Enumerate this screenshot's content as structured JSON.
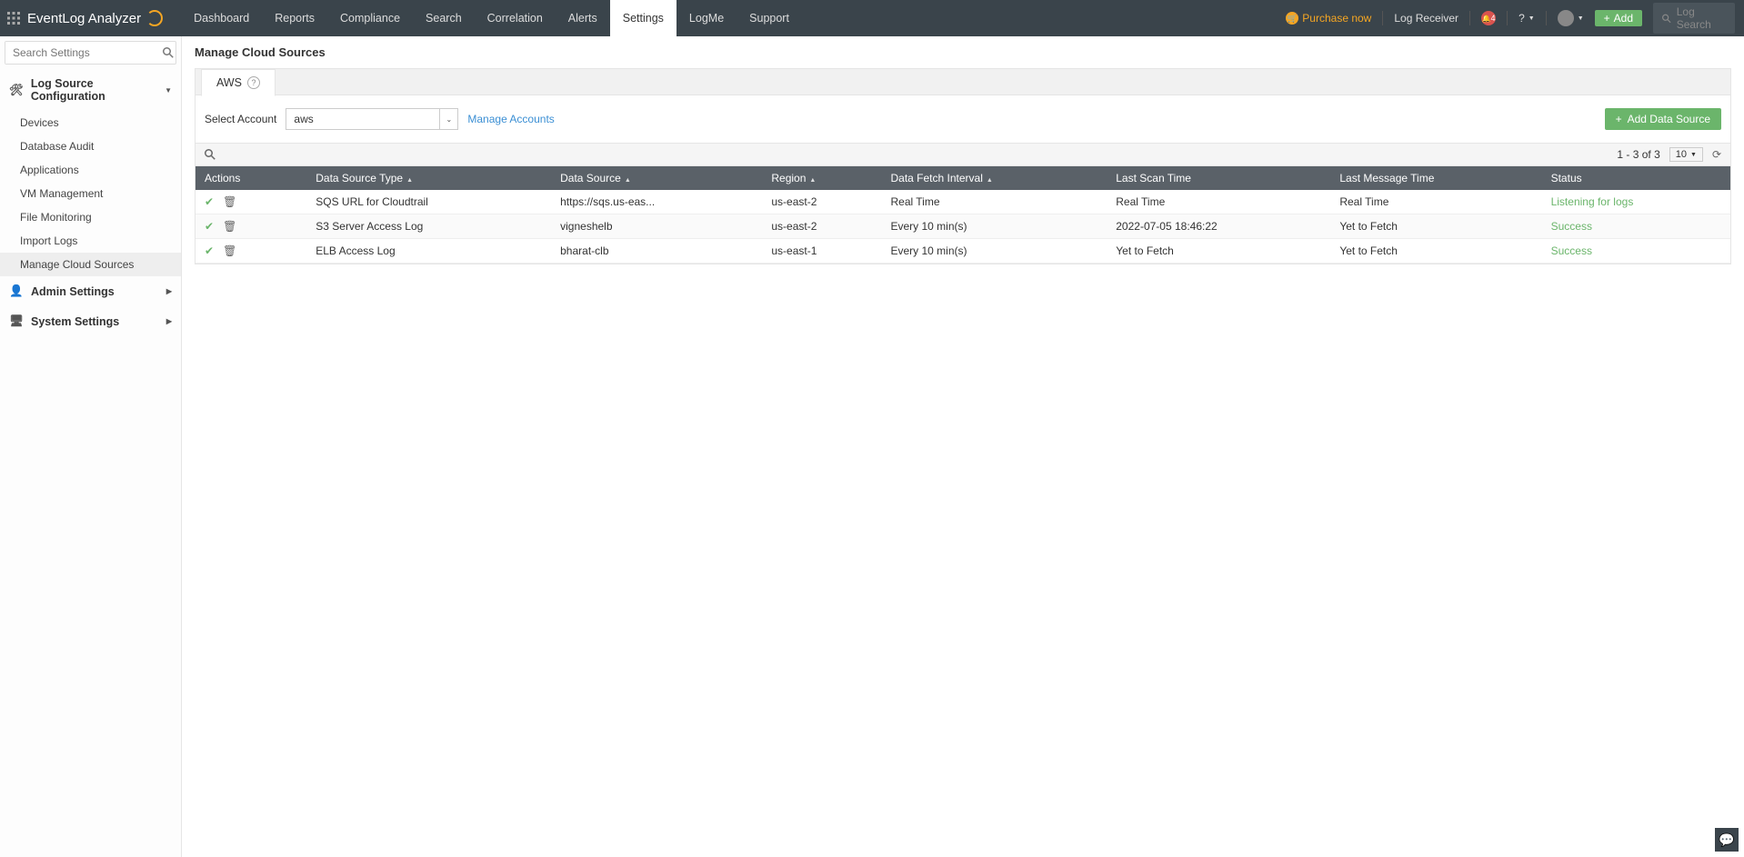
{
  "top": {
    "purchase": "Purchase now",
    "logReceiver": "Log Receiver",
    "notif": "4",
    "help": "?",
    "add": "Add",
    "logSearch": "Log Search"
  },
  "brand": "EventLog Analyzer",
  "nav": [
    "Dashboard",
    "Reports",
    "Compliance",
    "Search",
    "Correlation",
    "Alerts",
    "Settings",
    "LogMe",
    "Support"
  ],
  "navActive": "Settings",
  "sidebar": {
    "searchPlaceholder": "Search Settings",
    "section1": "Log Source Configuration",
    "subs": [
      "Devices",
      "Database Audit",
      "Applications",
      "VM Management",
      "File Monitoring",
      "Import Logs",
      "Manage Cloud Sources"
    ],
    "activeSub": "Manage Cloud Sources",
    "section2": "Admin Settings",
    "section3": "System Settings"
  },
  "page": {
    "title": "Manage Cloud Sources",
    "tab": "AWS",
    "selectAccountLabel": "Select Account",
    "selectedAccount": "aws",
    "manageAccounts": "Manage Accounts",
    "addDataSource": "Add Data Source",
    "pagination": "1 - 3 of 3",
    "pageSize": "10"
  },
  "columns": [
    "Actions",
    "Data Source Type",
    "Data Source",
    "Region",
    "Data Fetch Interval",
    "Last Scan Time",
    "Last Message Time",
    "Status"
  ],
  "rows": [
    {
      "type": "SQS URL for Cloudtrail",
      "source": "https://sqs.us-eas...",
      "region": "us-east-2",
      "interval": "Real Time",
      "lastScan": "Real Time",
      "lastMsg": "Real Time",
      "status": "Listening for logs"
    },
    {
      "type": "S3 Server Access Log",
      "source": "vigneshelb",
      "region": "us-east-2",
      "interval": "Every 10 min(s)",
      "lastScan": "2022-07-05 18:46:22",
      "lastMsg": "Yet to Fetch",
      "status": "Success"
    },
    {
      "type": "ELB Access Log",
      "source": "bharat-clb",
      "region": "us-east-1",
      "interval": "Every 10 min(s)",
      "lastScan": "Yet to Fetch",
      "lastMsg": "Yet to Fetch",
      "status": "Success"
    }
  ]
}
